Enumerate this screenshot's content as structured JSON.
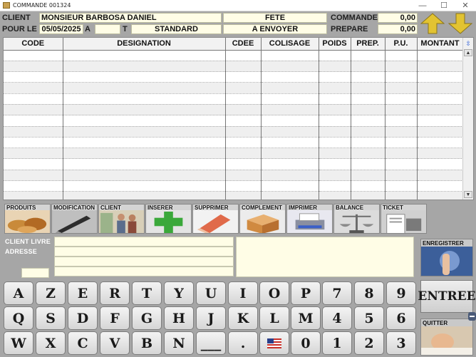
{
  "window": {
    "title": "COMMANDE 001324",
    "minimize": "—",
    "maximize": "☐",
    "close": "✕"
  },
  "header": {
    "client_label": "CLIENT",
    "client_name": "MONSIEUR BARBOSA DANIEL",
    "event": "FETE",
    "commande_label": "COMMANDE",
    "commande_value": "0,00",
    "pour_le_label": "POUR LE",
    "date": "05/05/2025",
    "a_label": "A",
    "t_label": "T",
    "mode": "STANDARD",
    "status": "A ENVOYER",
    "prepare_label": "PREPARE",
    "prepare_value": "0,00"
  },
  "grid": {
    "columns": [
      "CODE",
      "DESIGNATION",
      "CDEE",
      "COLISAGE",
      "POIDS",
      "PREP.",
      "P.U.",
      "MONTANT"
    ],
    "corner_icon": "⇳",
    "rows": 14
  },
  "toolbar": [
    {
      "label": "PRODUITS",
      "icon": "bread-icon"
    },
    {
      "label": "MODIFICATION",
      "icon": "pen-icon"
    },
    {
      "label": "CLIENT",
      "icon": "people-icon"
    },
    {
      "label": "INSERER",
      "icon": "plus-icon"
    },
    {
      "label": "SUPPRIMER",
      "icon": "eraser-icon"
    },
    {
      "label": "COMPLEMENT",
      "icon": "box-icon"
    },
    {
      "label": "IMPRIMER",
      "icon": "printer-icon"
    },
    {
      "label": "BALANCE",
      "icon": "scale-icon"
    },
    {
      "label": "TICKET",
      "icon": "receipt-icon"
    }
  ],
  "delivery": {
    "client_livre_label": "CLIENT LIVRE",
    "adresse_label": "ADRESSE"
  },
  "side": {
    "enregistrer": "ENREGISTRER",
    "entree": "ENTREE",
    "quitter": "QUITTER"
  },
  "keyboard": {
    "row1": [
      "A",
      "Z",
      "E",
      "R",
      "T",
      "Y",
      "U",
      "I",
      "O",
      "P",
      "7",
      "8",
      "9"
    ],
    "row2": [
      "Q",
      "S",
      "D",
      "F",
      "G",
      "H",
      "J",
      "K",
      "L",
      "M",
      "4",
      "5",
      "6"
    ],
    "row3": [
      "W",
      "X",
      "C",
      "V",
      "B",
      "N",
      "___",
      ".",
      "",
      "0",
      "1",
      "2",
      "3"
    ]
  },
  "colors": {
    "background": "#a6a6a6",
    "field": "#fffde6",
    "arrow": "#e2c332"
  }
}
